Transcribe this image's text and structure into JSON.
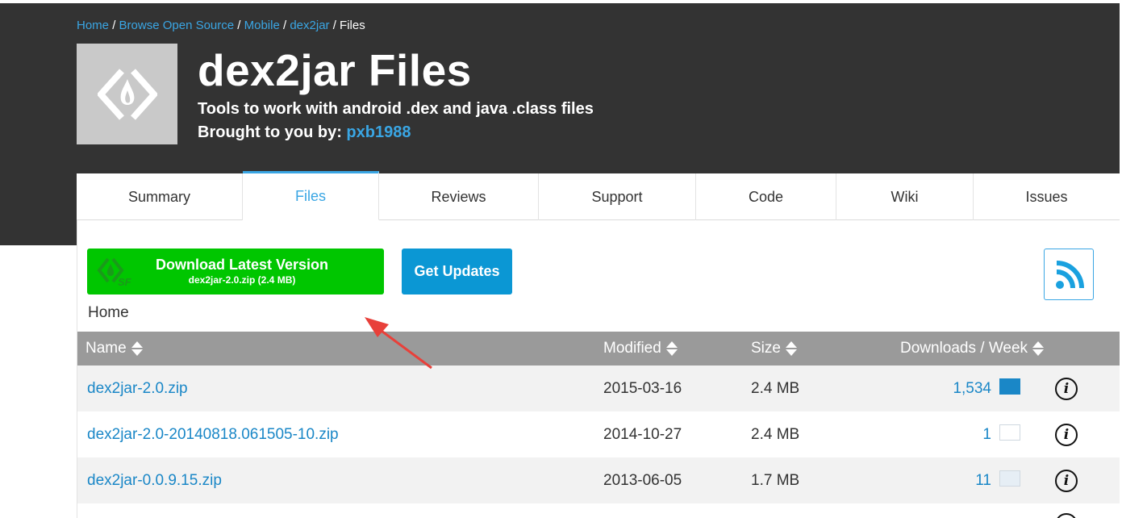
{
  "breadcrumb": {
    "items": [
      "Home",
      "Browse Open Source",
      "Mobile",
      "dex2jar"
    ],
    "current": "Files",
    "separator": "/"
  },
  "project": {
    "title": "dex2jar Files",
    "description": "Tools to work with android .dex and java .class files",
    "author_prefix": "Brought to you by:",
    "author": "pxb1988"
  },
  "tabs": [
    {
      "label": "Summary",
      "active": false
    },
    {
      "label": "Files",
      "active": true
    },
    {
      "label": "Reviews",
      "active": false
    },
    {
      "label": "Support",
      "active": false
    },
    {
      "label": "Code",
      "active": false
    },
    {
      "label": "Wiki",
      "active": false
    },
    {
      "label": "Issues",
      "active": false
    }
  ],
  "actions": {
    "download_label": "Download Latest Version",
    "download_file": "dex2jar-2.0.zip (2.4 MB)",
    "updates_label": "Get Updates",
    "rss_icon": "rss-icon"
  },
  "folder": "Home",
  "table": {
    "columns": [
      "Name",
      "Modified",
      "Size",
      "Downloads / Week"
    ],
    "rows": [
      {
        "name": "dex2jar-2.0.zip",
        "modified": "2015-03-16",
        "size": "2.4 MB",
        "downloads": "1,534"
      },
      {
        "name": "dex2jar-2.0-20140818.061505-10.zip",
        "modified": "2014-10-27",
        "size": "2.4 MB",
        "downloads": "1"
      },
      {
        "name": "dex2jar-0.0.9.15.zip",
        "modified": "2013-06-05",
        "size": "1.7 MB",
        "downloads": "11"
      }
    ]
  },
  "colors": {
    "header_bg": "#333333",
    "link": "#3aa6e4",
    "download_green": "#00c600",
    "updates_blue": "#0b97d4",
    "table_header": "#9a9a9a",
    "annotation_arrow": "#e8403a"
  }
}
